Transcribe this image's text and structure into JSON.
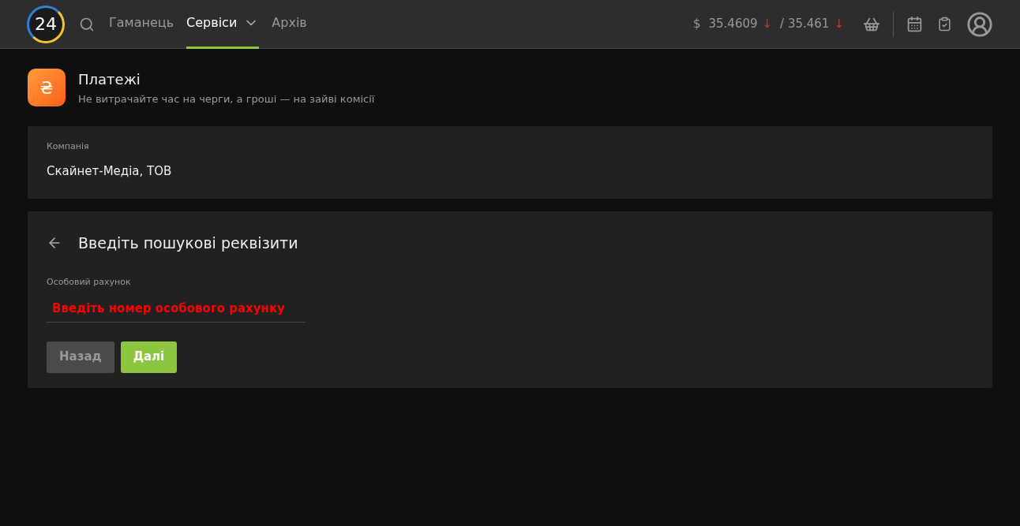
{
  "header": {
    "logo": "24",
    "nav": [
      {
        "label": "Гаманець",
        "selected": false,
        "dropdown": false
      },
      {
        "label": "Сервіси",
        "selected": true,
        "dropdown": true
      },
      {
        "label": "Архів",
        "selected": false,
        "dropdown": false
      }
    ],
    "rate": {
      "currency": "$",
      "buy": "35.4609",
      "buy_arrow": "↓",
      "sell": "/ 35.461",
      "sell_arrow": "↓"
    }
  },
  "page": {
    "icon": "₴",
    "title": "Платежі",
    "subtitle": "Не витрачайте час на черги, а гроші — на зайві комісії"
  },
  "company": {
    "label": "Компанія",
    "value": "Скайнет-Медіа, ТОВ"
  },
  "form": {
    "title": "Введіть пошукові реквізити",
    "field": {
      "label": "Особовий рахунок",
      "placeholder": "Введіть номер особового рахунку"
    },
    "buttons": [
      {
        "label": "Назад",
        "kind": "secondary"
      },
      {
        "label": "Далі",
        "kind": "primary"
      }
    ]
  }
}
